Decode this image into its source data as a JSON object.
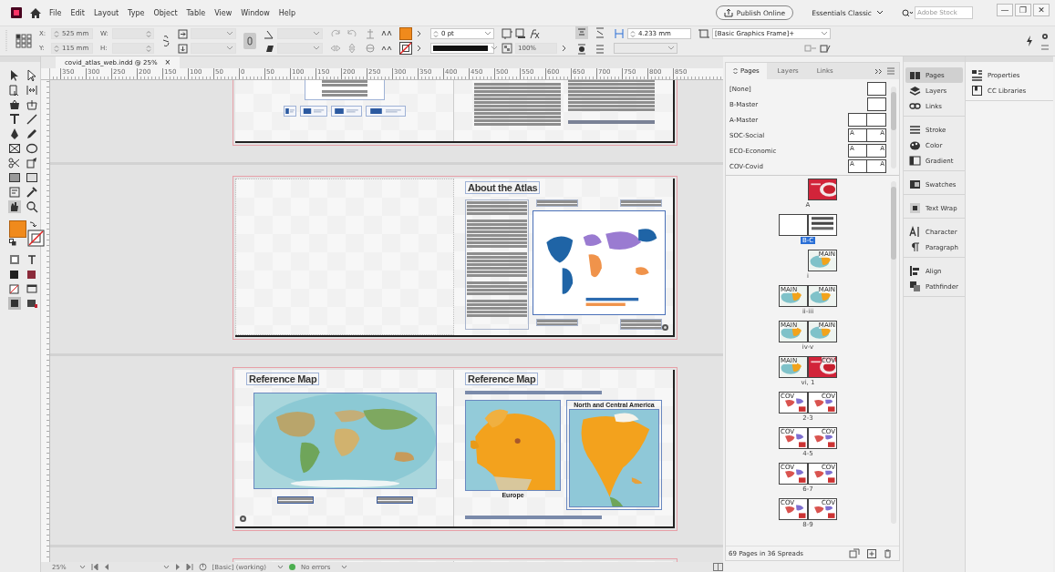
{
  "menubar": {
    "menus": [
      "File",
      "Edit",
      "Layout",
      "Type",
      "Object",
      "Table",
      "View",
      "Window",
      "Help"
    ],
    "publish_button": "Publish Online",
    "workspace": "Essentials Classic",
    "stock_search": {
      "placeholder": "Adobe Stock"
    },
    "window_controls": [
      "—",
      "❐",
      "✕"
    ]
  },
  "control_bar": {
    "x": {
      "label": "X:",
      "value": "525 mm"
    },
    "y": {
      "label": "Y:",
      "value": "115 mm"
    },
    "w": {
      "label": "W:"
    },
    "h": {
      "label": "H:"
    },
    "stroke_weight": "0 pt",
    "opacity": "100%",
    "spacing": "4.233 mm",
    "object_style": "[Basic Graphics Frame]+"
  },
  "document_tab": {
    "title": "covid_atlas_web.indd @ 25%",
    "close": "×"
  },
  "ruler": {
    "labels": [
      "350",
      "300",
      "250",
      "200",
      "150",
      "100",
      "50",
      "0",
      "50",
      "100",
      "150",
      "200",
      "250",
      "300",
      "350",
      "400",
      "450",
      "500",
      "550",
      "600",
      "650",
      "700",
      "750",
      "800",
      "850"
    ]
  },
  "spreads": [
    {
      "kind": "appendix"
    },
    {
      "kind": "about",
      "heading": "About the Atlas"
    },
    {
      "kind": "maps",
      "headings": [
        "Reference Map",
        "Reference Map"
      ],
      "map_captions": [
        "Europe",
        "North and Central America"
      ]
    },
    {
      "kind": "edge"
    }
  ],
  "pages_panel": {
    "tabs": [
      {
        "label": "Pages",
        "selected": true
      },
      {
        "label": "Layers",
        "selected": false
      },
      {
        "label": "Links",
        "selected": false
      }
    ],
    "masters": [
      {
        "name": "[None]",
        "kind": "single"
      },
      {
        "name": "B-Master",
        "kind": "single"
      },
      {
        "name": "A-Master",
        "kind": "spread"
      },
      {
        "name": "SOC-Social",
        "kind": "spread",
        "prefixes": [
          "A",
          "A"
        ]
      },
      {
        "name": "ECO-Economic",
        "kind": "spread",
        "prefixes": [
          "A",
          "A"
        ]
      },
      {
        "name": "COV-Covid",
        "kind": "spread",
        "prefixes": [
          "A",
          "A"
        ]
      }
    ],
    "spreads": [
      {
        "label": "A",
        "selected": false,
        "kind": "right"
      },
      {
        "label": "B-C",
        "selected": true,
        "kind": "spread"
      },
      {
        "label": "i",
        "selected": false,
        "kind": "right",
        "prefixes": [
          "MAIN"
        ]
      },
      {
        "label": "ii-iii",
        "selected": false,
        "kind": "spread",
        "prefixes": [
          "MAIN",
          "MAIN"
        ]
      },
      {
        "label": "iv-v",
        "selected": false,
        "kind": "spread",
        "prefixes": [
          "MAIN",
          "MAIN"
        ]
      },
      {
        "label": "vi, 1",
        "selected": false,
        "kind": "spread",
        "prefixes": [
          "MAIN",
          "COV"
        ]
      },
      {
        "label": "2-3",
        "selected": false,
        "kind": "spread",
        "prefixes": [
          "COV",
          "COV"
        ]
      },
      {
        "label": "4-5",
        "selected": false,
        "kind": "spread",
        "prefixes": [
          "COV",
          "COV"
        ]
      },
      {
        "label": "6-7",
        "selected": false,
        "kind": "spread",
        "prefixes": [
          "COV",
          "COV"
        ]
      },
      {
        "label": "8-9",
        "selected": false,
        "kind": "spread",
        "prefixes": [
          "COV",
          "COV"
        ]
      }
    ],
    "footer": "69 Pages in 36 Spreads"
  },
  "dock": {
    "groups": [
      [
        {
          "label": "Pages",
          "selected": true
        },
        {
          "label": "Layers",
          "selected": false
        },
        {
          "label": "Links",
          "selected": false
        }
      ],
      [
        {
          "label": "Stroke",
          "selected": false
        },
        {
          "label": "Color",
          "selected": false
        },
        {
          "label": "Gradient",
          "selected": false
        }
      ],
      [
        {
          "label": "Swatches",
          "selected": false
        }
      ],
      [
        {
          "label": "Text Wrap",
          "selected": false
        }
      ],
      [
        {
          "label": "Character",
          "selected": false
        },
        {
          "label": "Paragraph",
          "selected": false
        }
      ],
      [
        {
          "label": "Align",
          "selected": false
        },
        {
          "label": "Pathfinder",
          "selected": false
        }
      ]
    ]
  },
  "properties_dock": {
    "items": [
      "Properties",
      "CC Libraries"
    ]
  },
  "status_bar": {
    "zoom": "25%",
    "preflight_profile": "[Basic] (working)",
    "preflight": "No errors"
  }
}
